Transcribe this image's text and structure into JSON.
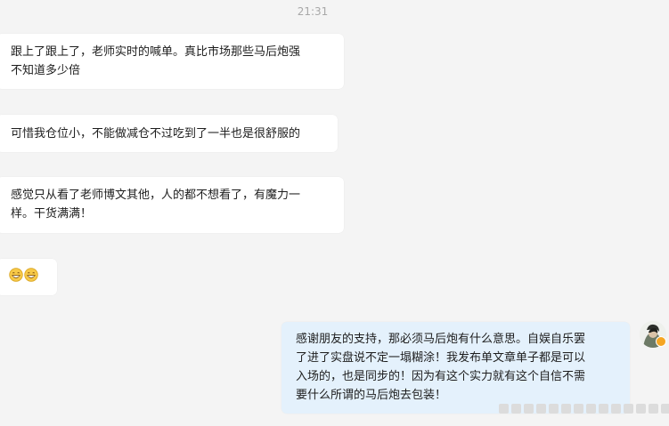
{
  "chat": {
    "timestamp": "21:31",
    "messages": [
      {
        "sender": "other",
        "text": "跟上了跟上了，老师实时的喊单。真比市场那些马后炮强\n不知道多少倍"
      },
      {
        "sender": "other",
        "text": "可惜我仓位小，不能做减仓不过吃到了一半也是很舒服的"
      },
      {
        "sender": "other",
        "text": "感觉只从看了老师博文其他，人的都不想看了，有魔力一\n样。干货满满！"
      },
      {
        "sender": "other",
        "emoji": [
          "grin-emoji",
          "grin-emoji"
        ]
      },
      {
        "sender": "self",
        "text": "感谢朋友的支持，那必须马后炮有什么意思。自娱自乐罢\n了进了实盘说不定一塌糊涂！我发布单文章单子都是可以\n入场的，也是同步的！因为有这个实力就有这个自信不需\n要什么所谓的马后炮去包装！"
      }
    ],
    "self_avatar": {
      "icon": "avatar",
      "badge": "verified-badge-icon",
      "badge_color": "#f5a623"
    },
    "colors": {
      "background": "#f4f4f4",
      "incoming_bubble": "#ffffff",
      "outgoing_bubble": "#e4f1fc",
      "emoji": "#f7c948"
    }
  }
}
